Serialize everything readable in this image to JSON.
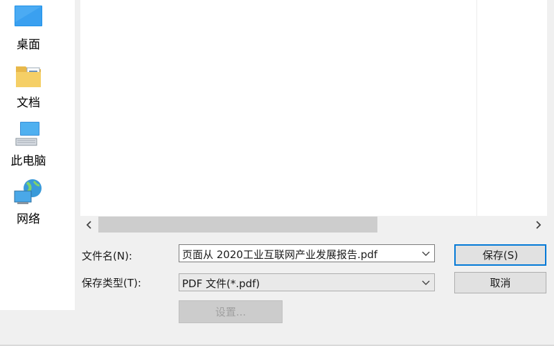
{
  "places": [
    {
      "label": "桌面",
      "icon": "desktop-icon"
    },
    {
      "label": "文档",
      "icon": "documents-folder-icon"
    },
    {
      "label": "此电脑",
      "icon": "this-pc-icon"
    },
    {
      "label": "网络",
      "icon": "network-icon"
    }
  ],
  "form": {
    "filename_label": "文件名(N):",
    "filename_value": "页面从 2020工业互联网产业发展报告.pdf",
    "filetype_label": "保存类型(T):",
    "filetype_value": "PDF 文件(*.pdf)",
    "settings_label": "设置..."
  },
  "buttons": {
    "save": "保存(S)",
    "cancel": "取消"
  },
  "colors": {
    "accent": "#0078d7",
    "scroll_thumb": "#cdcdcd",
    "window_bg": "#f0f0f0"
  }
}
